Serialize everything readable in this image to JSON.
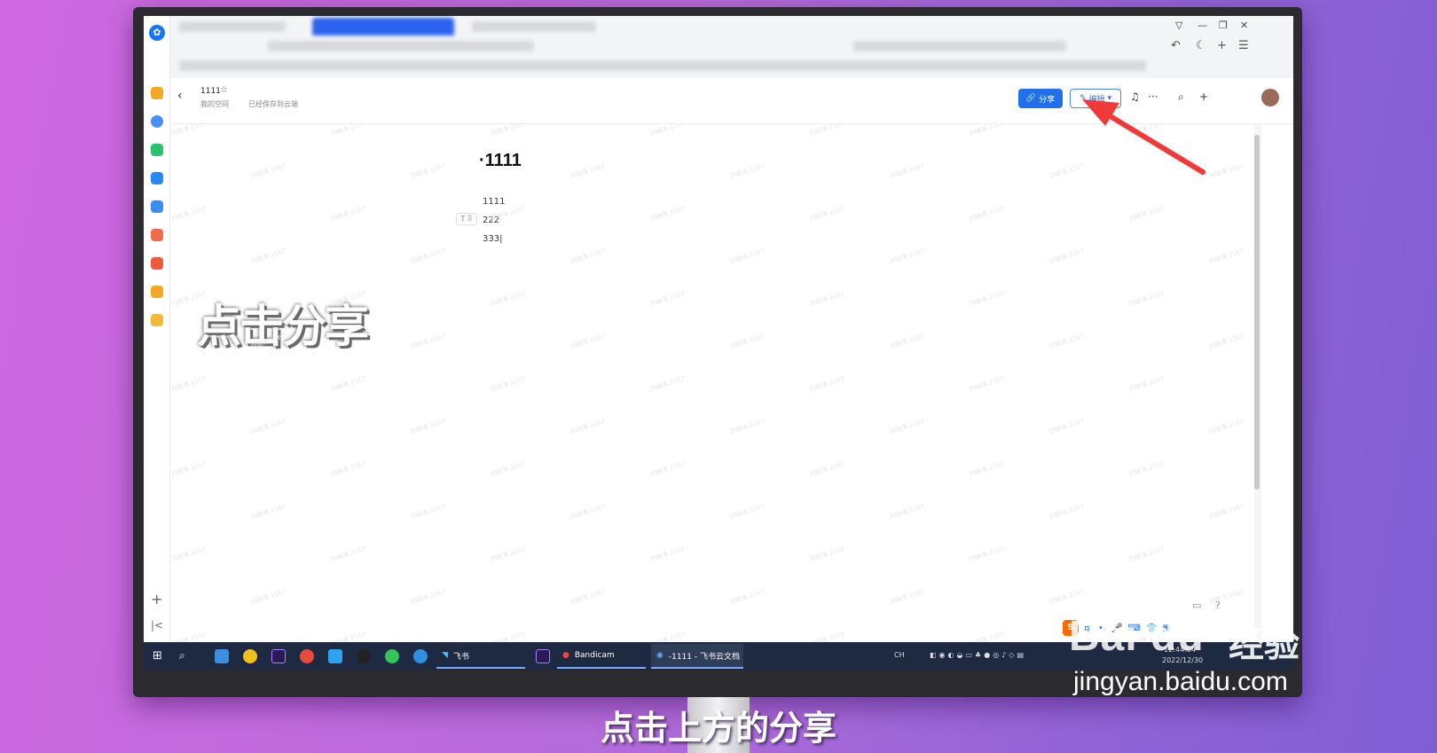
{
  "doc": {
    "tab_title": "1111",
    "breadcrumb": "我的空间",
    "save_status": "已经保存到云端",
    "heading": "·1111",
    "paragraphs": [
      "1111",
      "222",
      "333|"
    ],
    "block_handle": "T ⠿",
    "watermark": "刘晓涛 2167"
  },
  "header": {
    "share_label": "分享",
    "edit_label": "编辑",
    "back": "‹",
    "star": "☆",
    "bell": "🔔",
    "more": "···",
    "search": "⌕",
    "plus": "+"
  },
  "overlay_caption": "点击分享",
  "subtitle": "点击上方的分享",
  "taskbar": {
    "apps": [
      {
        "label": "飞书"
      },
      {
        "label": "Bandicam"
      },
      {
        "label": "-1111 - 飞书云文档"
      }
    ],
    "tray_lang": "CH",
    "time": "12:44:04",
    "date": "2022/12/30"
  },
  "ime": {
    "logo": "S",
    "mode": "中"
  },
  "branding": {
    "baidu_text": "Bai du",
    "baidu_cn": "经验",
    "url": "jingyan.baidu.com"
  },
  "colors": {
    "accent": "#2070ee",
    "arrow": "#f03a3a",
    "taskbar": "#1d2a42"
  }
}
